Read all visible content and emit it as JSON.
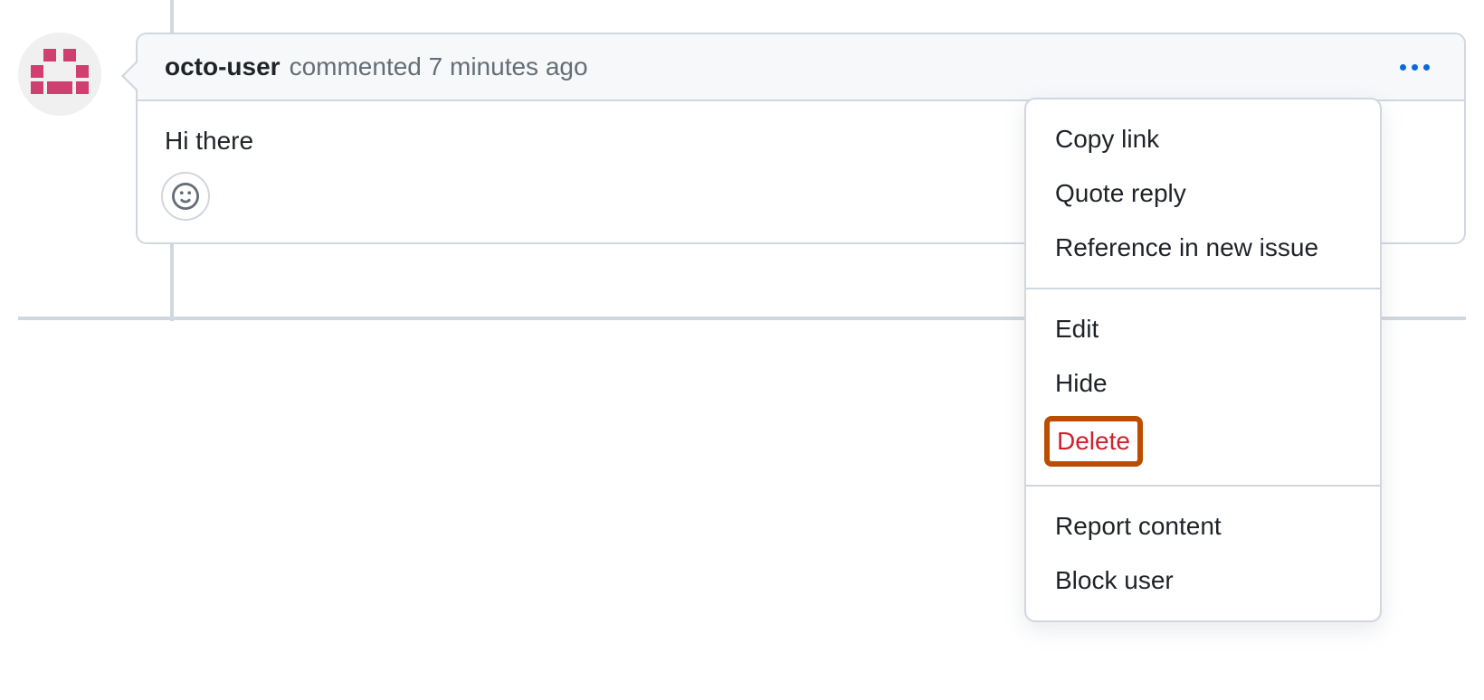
{
  "comment": {
    "username": "octo-user",
    "action_text": "commented",
    "timestamp": "7 minutes ago",
    "body": "Hi there"
  },
  "menu": {
    "copy_link": "Copy link",
    "quote_reply": "Quote reply",
    "reference_issue": "Reference in new issue",
    "edit": "Edit",
    "hide": "Hide",
    "delete": "Delete",
    "report": "Report content",
    "block": "Block user"
  },
  "colors": {
    "border": "#d0d7de",
    "header_bg": "#f6f8fa",
    "link_blue": "#0969da",
    "danger": "#cf222e",
    "highlight_box": "#bc4c00",
    "avatar_pink": "#cf3f6f"
  }
}
